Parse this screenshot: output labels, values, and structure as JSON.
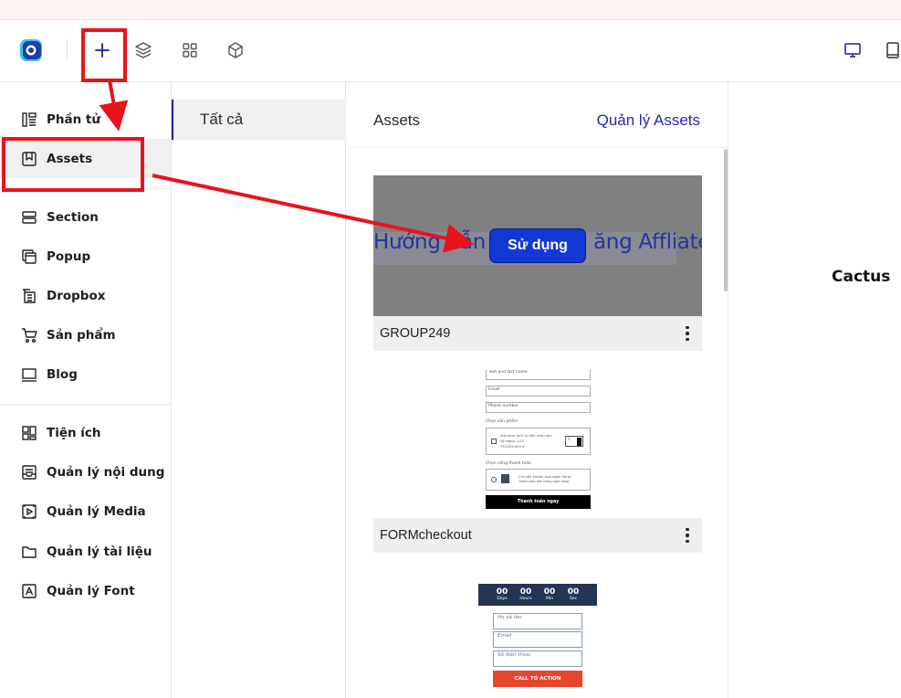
{
  "toolbar": {
    "tools": [
      {
        "icon": "plus-icon"
      },
      {
        "icon": "layers-icon"
      },
      {
        "icon": "grid-icon"
      },
      {
        "icon": "cube-icon"
      }
    ],
    "devices": [
      {
        "icon": "desktop-icon"
      },
      {
        "icon": "tablet-icon"
      }
    ]
  },
  "sidebar": {
    "items": [
      {
        "label": "Phần tử",
        "icon": "elements-icon"
      },
      {
        "label": "Assets",
        "icon": "bookmark-icon",
        "active": true
      },
      {
        "label": "Section",
        "icon": "section-icon"
      },
      {
        "label": "Popup",
        "icon": "popup-icon"
      },
      {
        "label": "Dropbox",
        "icon": "dropbox-icon"
      },
      {
        "label": "Sản phẩm",
        "icon": "cart-icon"
      },
      {
        "label": "Blog",
        "icon": "blog-icon"
      },
      {
        "label": "Tiện ích",
        "icon": "widgets-icon"
      },
      {
        "label": "Quản lý nội dung",
        "icon": "content-icon"
      },
      {
        "label": "Quản lý Media",
        "icon": "media-icon"
      },
      {
        "label": "Quản lý tài liệu",
        "icon": "folder-icon"
      },
      {
        "label": "Quản lý Font",
        "icon": "font-icon"
      }
    ]
  },
  "categories": {
    "all": "Tất cả"
  },
  "assets": {
    "title": "Assets",
    "manage_link": "Quản lý Assets",
    "use_button": "Sử dụng",
    "cards": [
      {
        "name": "GROUP249",
        "heading_left": "Hướng dẫn",
        "heading_right": "ăng Affliate"
      },
      {
        "name": "FORMcheckout",
        "form": {
          "field1": "Text and last name",
          "field2": "Email",
          "field3": "Phone number",
          "product_label": "Chọn sản phẩm",
          "product_name": "test form dịch vụ đầu nhân làm",
          "product_qty": "Số lượng: 1/12",
          "product_price": "750.000.000 đ",
          "qty_value": "1",
          "payment_label": "Chọn cổng thanh toán",
          "payment_name": "Chuyển khoản qua ngân hàng",
          "payment_desc": "Thanh toán trên trang ngân hàng",
          "submit": "Thanh toán ngay"
        }
      },
      {
        "name": "",
        "countdown": {
          "units": [
            {
              "value": "00",
              "label": "Days"
            },
            {
              "value": "00",
              "label": "Hours"
            },
            {
              "value": "00",
              "label": "Min"
            },
            {
              "value": "00",
              "label": "Sec"
            }
          ]
        },
        "form": {
          "name_placeholder": "Họ và tên",
          "email_placeholder": "Email",
          "phone_placeholder": "Số điện thoại",
          "cta": "CALL TO ACTION"
        }
      }
    ]
  },
  "preview": {
    "text": "Cactus"
  },
  "colors": {
    "accent": "#2626b8",
    "annotation": "#e8141b",
    "use_button": "#1238d6"
  }
}
